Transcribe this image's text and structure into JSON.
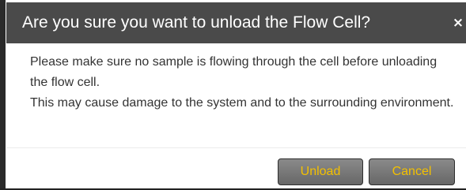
{
  "dialog": {
    "title": "Are you sure you want to unload the Flow Cell?",
    "close_symbol": "×",
    "message_line_1": "Please make sure no sample is flowing through the cell before unloading the flow cell.",
    "message_line_2": "This may cause damage to the system and to the surrounding environment.",
    "buttons": {
      "unload_label": "Unload",
      "cancel_label": "Cancel"
    }
  },
  "colors": {
    "header_bg": "#4a4a4a",
    "button_text": "#f3c000",
    "accent": "#e0b400"
  }
}
